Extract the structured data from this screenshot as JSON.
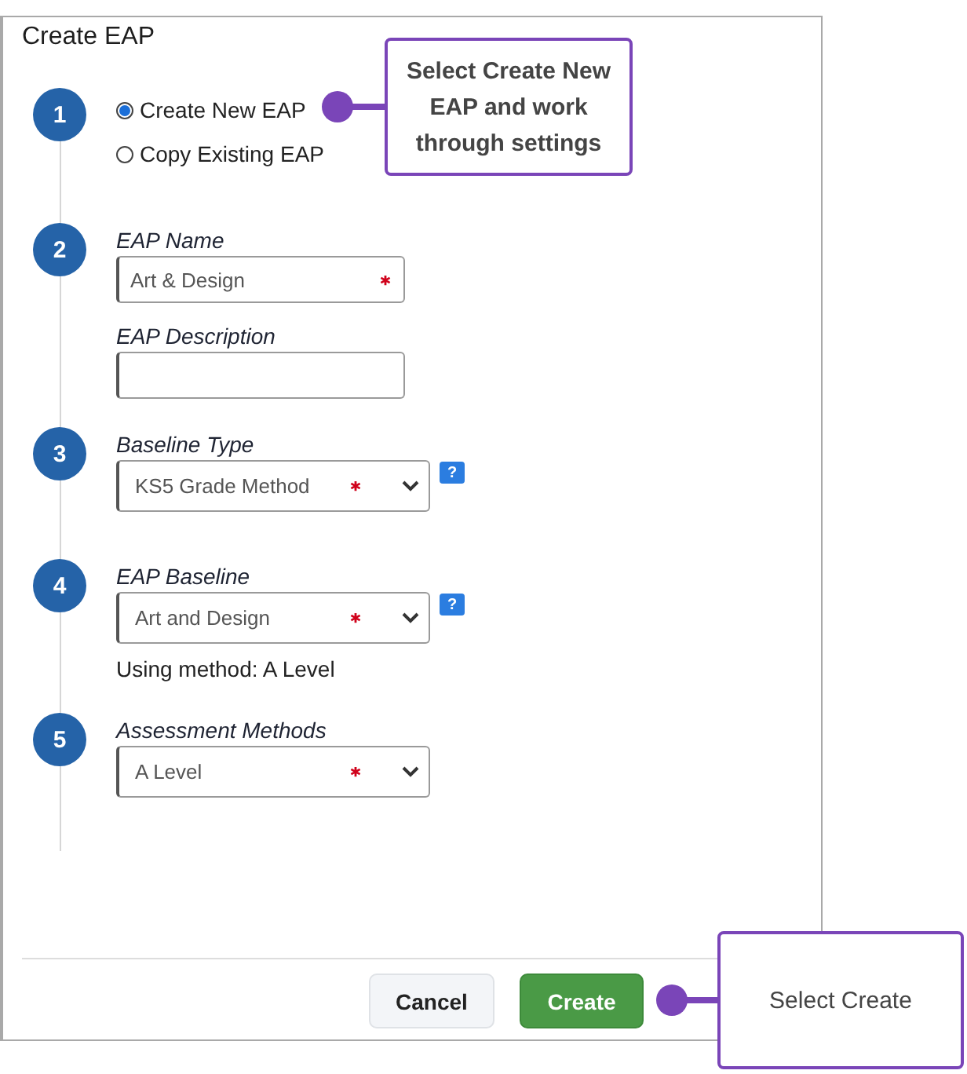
{
  "dialog": {
    "title": "Create EAP"
  },
  "steps": [
    {
      "number": "1",
      "kind": "radios",
      "options": [
        {
          "label": "Create New EAP",
          "selected": true
        },
        {
          "label": "Copy Existing EAP",
          "selected": false
        }
      ]
    },
    {
      "number": "2",
      "kind": "fields",
      "fields": [
        {
          "kind": "text",
          "label": "EAP Name",
          "value": "Art & Design",
          "required": true
        },
        {
          "kind": "text",
          "label": "EAP Description",
          "required": false
        }
      ]
    },
    {
      "number": "3",
      "kind": "fields",
      "fields": [
        {
          "kind": "select",
          "label": "Baseline Type",
          "value": "KS5 Grade Method",
          "required": true,
          "help": "?"
        }
      ]
    },
    {
      "number": "4",
      "kind": "fields",
      "fields": [
        {
          "kind": "select",
          "label": "EAP Baseline",
          "value": "Art and Design",
          "required": true,
          "help": "?",
          "note": "Using method: A Level"
        }
      ]
    },
    {
      "number": "5",
      "kind": "fields",
      "fields": [
        {
          "kind": "select",
          "label": "Assessment Methods",
          "value": "A Level",
          "required": true
        }
      ]
    }
  ],
  "buttons": [
    {
      "label": "Cancel",
      "kind": "secondary"
    },
    {
      "label": "Create",
      "kind": "primary"
    }
  ],
  "callouts": [
    {
      "text": "Select Create New EAP and work through settings"
    },
    {
      "text": "Select Create"
    }
  ]
}
